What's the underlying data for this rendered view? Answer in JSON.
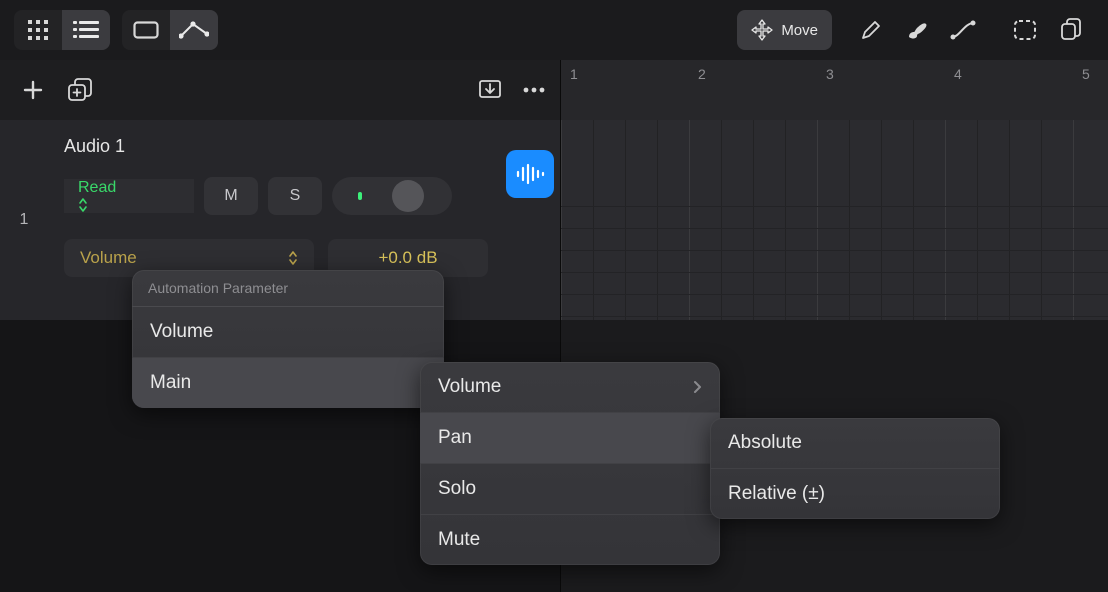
{
  "toolbar": {
    "grid_icon": "grid-3x3",
    "list_icon": "list",
    "box_icon": "box",
    "curve_icon": "automation-curve",
    "move_label": "Move",
    "pencil_icon": "pencil",
    "brush_icon": "brush",
    "curve_tool_icon": "curve",
    "marquee_icon": "marquee",
    "copy_icon": "copy"
  },
  "header": {
    "add_icon": "plus",
    "duplicate_icon": "duplicate",
    "download_icon": "catch-download",
    "more_icon": "more-horizontal"
  },
  "ruler": {
    "labels": [
      "1",
      "2",
      "3",
      "4",
      "5"
    ]
  },
  "track": {
    "number": "1",
    "name": "Audio 1",
    "automation_mode": "Read",
    "mute_label": "M",
    "solo_label": "S",
    "param_name": "Volume",
    "param_value": "+0.0 dB"
  },
  "menu1": {
    "header": "Automation Parameter",
    "items": [
      "Volume",
      "Main"
    ]
  },
  "menu2": {
    "items": [
      "Volume",
      "Pan",
      "Solo",
      "Mute"
    ]
  },
  "menu3": {
    "items": [
      "Absolute",
      "Relative (±)"
    ]
  }
}
